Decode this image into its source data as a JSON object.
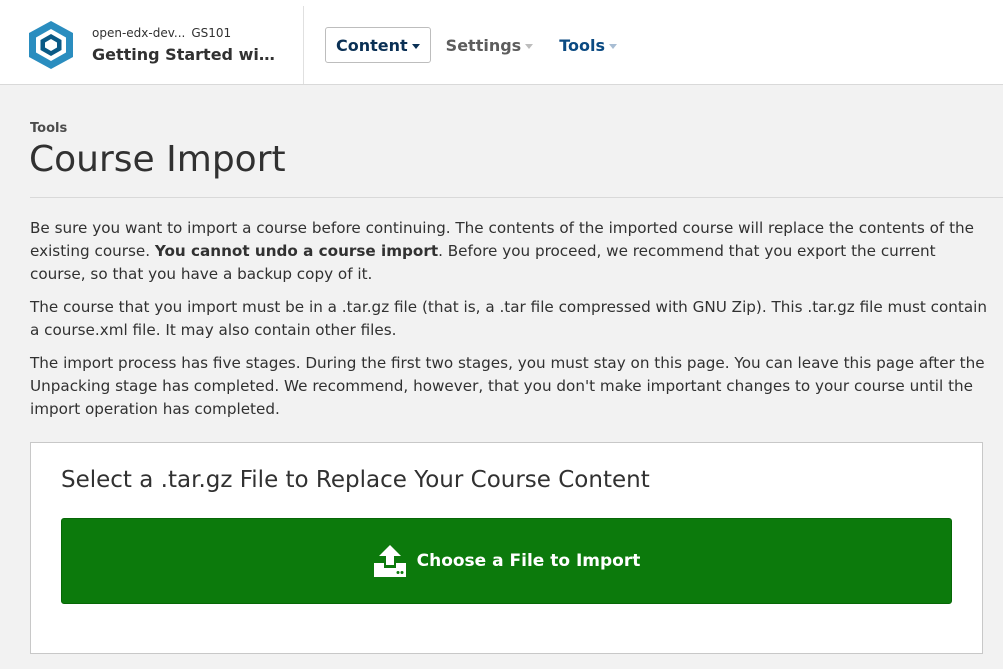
{
  "header": {
    "org": "open-edx-dev...",
    "course_number": "GS101",
    "course_title": "Getting Started with O...",
    "nav": {
      "content": "Content",
      "settings": "Settings",
      "tools": "Tools"
    }
  },
  "page": {
    "breadcrumb": "Tools",
    "title": "Course Import"
  },
  "intro": {
    "p1_start": "Be sure you want to import a course before continuing. The contents of the imported course will replace the contents of the existing course. ",
    "p1_bold": "You cannot undo a course import",
    "p1_end": ". Before you proceed, we recommend that you export the current course, so that you have a backup copy of it.",
    "p2": "The course that you import must be in a .tar.gz file (that is, a .tar file compressed with GNU Zip). This .tar.gz file must contain a course.xml file. It may also contain other files.",
    "p3": "The import process has five stages. During the first two stages, you must stay on this page. You can leave this page after the Unpacking stage has completed. We recommend, however, that you don't make important changes to your course until the import operation has completed."
  },
  "import_panel": {
    "title": "Select a .tar.gz File to Replace Your Course Content",
    "button_label": "Choose a File to Import",
    "button_icon": "upload-icon"
  },
  "colors": {
    "brand_logo": "#2a8dbf",
    "nav_active": "#0a3055",
    "nav_link": "#0b4a82",
    "primary_button": "#0c7a0c"
  }
}
